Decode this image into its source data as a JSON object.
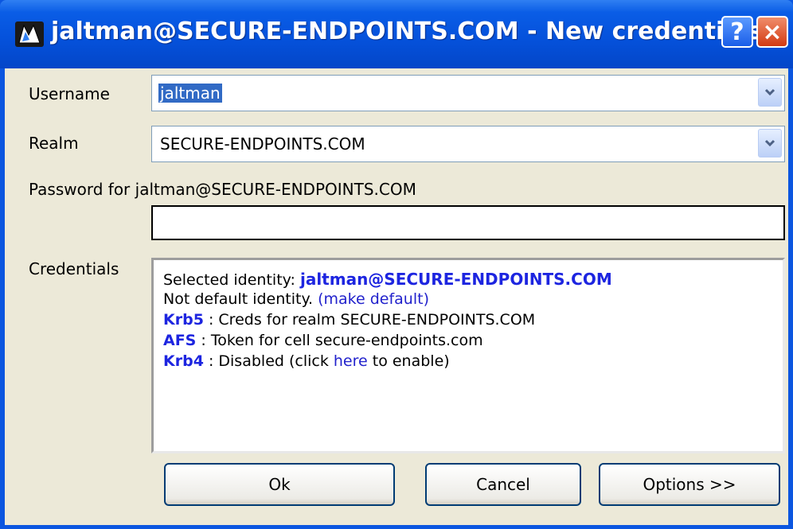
{
  "window": {
    "title": "jaltman@SECURE-ENDPOINTS.COM - New credentials",
    "help_label": "?",
    "close_label": "×"
  },
  "form": {
    "username_label": "Username",
    "username_value": "jaltman",
    "realm_label": "Realm",
    "realm_value": "SECURE-ENDPOINTS.COM",
    "password_label": "Password for jaltman@SECURE-ENDPOINTS.COM",
    "password_value": "",
    "credentials_label": "Credentials"
  },
  "credentials": {
    "selected_prefix": "Selected identity: ",
    "selected_identity": "jaltman@SECURE-ENDPOINTS.COM",
    "default_text": "Not default identity.  ",
    "make_default_link": "(make default)",
    "krb5_name": "Krb5",
    "krb5_text": " : Creds for realm SECURE-ENDPOINTS.COM",
    "afs_name": "AFS",
    "afs_text": "  : Token for cell secure-endpoints.com",
    "krb4_name": "Krb4",
    "krb4_text_before": " : Disabled  (click ",
    "krb4_here_link": "here",
    "krb4_text_after": " to enable)"
  },
  "buttons": {
    "ok": "Ok",
    "cancel": "Cancel",
    "options": "Options >>"
  },
  "colors": {
    "titlebar": "#0552dc",
    "dialog_bg": "#ece9d8",
    "accent_blue": "#1d25e0",
    "selection": "#316ac5"
  }
}
